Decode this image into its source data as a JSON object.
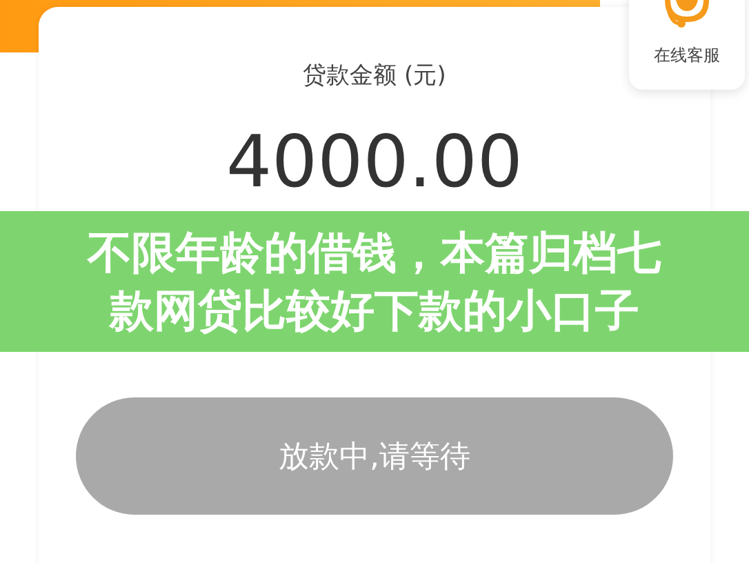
{
  "service_widget": {
    "label": "在线客服"
  },
  "loan_card": {
    "label": "贷款金额 (元)",
    "amount": "4000.00"
  },
  "button": {
    "label": "放款中,请等待",
    "disabled": true
  },
  "banner": {
    "title": "不限年龄的借钱，本篇归档七款网贷比较好下款的小口子"
  }
}
